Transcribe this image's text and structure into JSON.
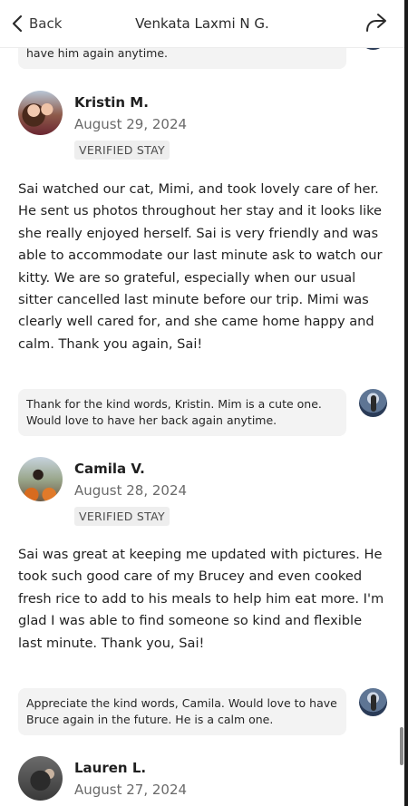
{
  "header": {
    "back_label": "Back",
    "title": "Venkata Laxmi N G."
  },
  "top_reply": {
    "text": "have him again anytime."
  },
  "reviews": [
    {
      "name": "Kristin M.",
      "date": "August 29, 2024",
      "badge": "VERIFIED STAY",
      "body": "Sai watched our cat, Mimi, and took lovely care of her. He sent us photos throughout her stay and it looks like she really enjoyed herself. Sai is very friendly and was able to accommodate our last minute ask to watch our kitty. We are so grateful, especially when our usual sitter cancelled last minute before our trip. Mimi was clearly well cared for, and she came home happy and calm. Thank you again, Sai!",
      "reply": "Thank for the kind words, Kristin. Mim is a cute one. Would love to have her back again anytime."
    },
    {
      "name": "Camila V.",
      "date": "August 28, 2024",
      "badge": "VERIFIED STAY",
      "body": "Sai was great at keeping me updated with pictures. He took such good care of my Brucey and even cooked fresh rice to add to his meals to help him eat more. I'm glad I was able to find someone so kind and flexible last minute. Thank you, Sai!",
      "reply": "Appreciate the kind words, Camila. Would love to have Bruce again in the future. He is a calm one."
    },
    {
      "name": "Lauren L.",
      "date": "August 27, 2024"
    }
  ],
  "icons": {
    "back": "chevron-left-icon",
    "share": "share-arrow-icon"
  }
}
